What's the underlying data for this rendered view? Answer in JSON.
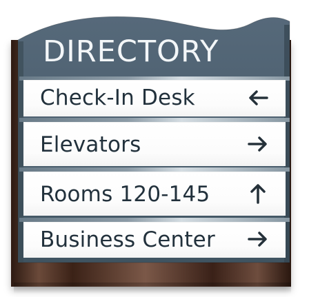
{
  "sign": {
    "title": "DIRECTORY",
    "rows": [
      {
        "label": "Check-In Desk",
        "arrow_icon": "left-arrow-icon"
      },
      {
        "label": "Elevators",
        "arrow_icon": "right-arrow-icon"
      },
      {
        "label": "Rooms 120-145",
        "arrow_icon": "up-arrow-icon"
      },
      {
        "label": "Business Center",
        "arrow_icon": "right-arrow-icon"
      }
    ],
    "colors": {
      "panel": "#4b5f6c",
      "panel_dark": "#3f5360",
      "text": "#22313c",
      "title_text": "#f3f6f8",
      "wood_dark": "#2d1a12",
      "wood_light": "#7b5848"
    }
  }
}
